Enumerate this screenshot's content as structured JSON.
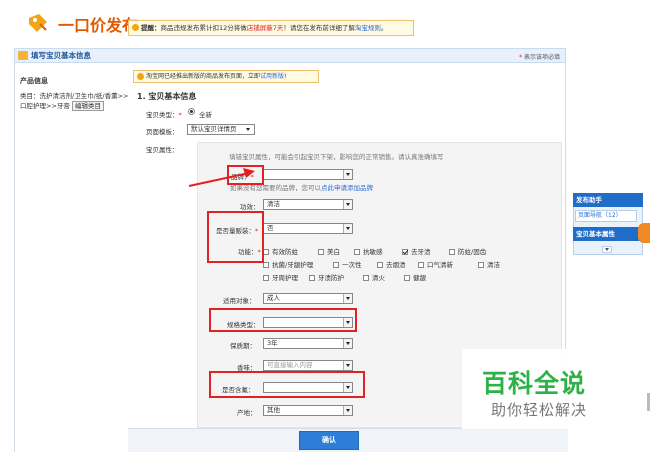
{
  "header": {
    "title": "一口价发布",
    "notice_label": "提醒：",
    "notice_text_a": "商品违规发布累计扣12分将做",
    "notice_text_red": "店铺屏蔽7天",
    "notice_text_b": "！请您在发布前详细了解",
    "notice_link": "淘宝规则",
    "notice_end": "。"
  },
  "section": {
    "title": "填写宝贝基本信息",
    "required_note": "表示该项必填",
    "star": "*"
  },
  "left": {
    "product_info_title": "产品信息",
    "category_text": "类目：洗护清洁剂/卫生巾/纸/香薰>>口腔护理>>牙膏",
    "edit_category": "编辑类目"
  },
  "tip": {
    "text": "淘宝网已经推出新版的商品发布页面，立即",
    "link": "试用新版",
    "end": "!"
  },
  "form": {
    "basic_title": "1. 宝贝基本信息",
    "type_label": "宝贝类型：",
    "type_value": "全新",
    "template_label": "页面模板：",
    "template_value": "默认宝贝详情页",
    "attr_label": "宝贝属性：",
    "attr_hint": "填错宝贝属性，可能会引起宝贝下架，影响您的正常销售。请认真准确填写",
    "brand_label": "品牌：",
    "brand_value": "",
    "brand_hint_a": "如果没有您需要的品牌，您可以",
    "brand_hint_link": "点此申请添加品牌",
    "efficacy_label": "功效：",
    "efficacy_value": "清洁",
    "flavor_label": "是否量贩装：",
    "flavor_value": "否",
    "function_label": "功能：",
    "functions": [
      {
        "label": "有效防蛀",
        "checked": false
      },
      {
        "label": "美白",
        "checked": false
      },
      {
        "label": "抗敏感",
        "checked": false
      },
      {
        "label": "去牙渍",
        "checked": true
      },
      {
        "label": "防蛀/固齿",
        "checked": false
      },
      {
        "label": "抗菌/牙龈护理",
        "checked": false
      },
      {
        "label": "一次性",
        "checked": false
      },
      {
        "label": "去烟渍",
        "checked": false
      },
      {
        "label": "口气清新",
        "checked": false
      },
      {
        "label": "清洁",
        "checked": false
      },
      {
        "label": "牙周护理",
        "checked": false
      },
      {
        "label": "牙渍防护",
        "checked": false
      },
      {
        "label": "清火",
        "checked": false
      },
      {
        "label": "健龈",
        "checked": false
      }
    ],
    "user_label": "适用对象：",
    "user_value": "成人",
    "spec_label": "规格类型：",
    "spec_value": "",
    "shelf_label": "保质期：",
    "shelf_value": "3年",
    "rec_label": "香味：",
    "rec_value": "可直接输入内容",
    "fluor_label": "是否含氟：",
    "fluor_value": "",
    "origin_label": "产地：",
    "origin_value": "其他"
  },
  "footer": {
    "confirm": "确认"
  },
  "helper": {
    "title": "发布助手",
    "item1": "页面导航（12）",
    "item2": "宝贝基本属性"
  },
  "watermark": {
    "title": "百科全说",
    "subtitle": "助你轻松解决"
  },
  "colors": {
    "accent": "#e15a00",
    "link": "#2a6ad0",
    "annotation": "#e02222",
    "button": "#2e7ed9",
    "watermark": "#2db245"
  }
}
